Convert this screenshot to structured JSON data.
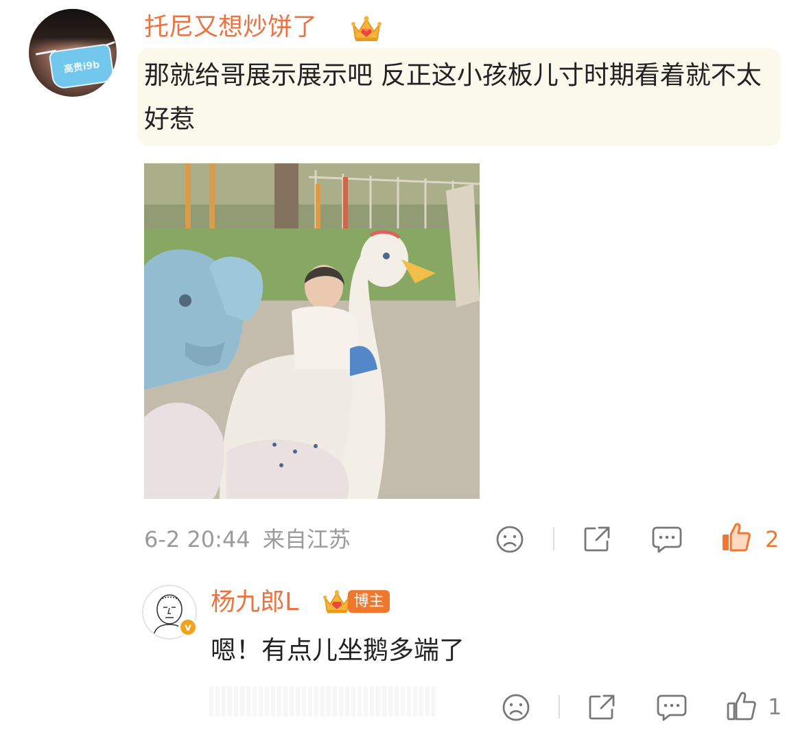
{
  "comment": {
    "username": "托尼又想炒饼了",
    "avatar_mask_text": "高贵i9b",
    "text": "那就给哥展示展示吧 反正这小孩板儿寸时期看着就不太好惹",
    "timestamp": "6-2 20:44",
    "location": "来自江苏",
    "like_count": "2",
    "liked": true
  },
  "reply": {
    "username": "杨九郎L",
    "author_tag": "博主",
    "verified_badge": "v",
    "text": "嗯！有点儿坐鹅多端了",
    "like_count": "1",
    "liked": false
  },
  "colors": {
    "username": "#eb7340",
    "like_active": "#f0772d",
    "meta": "#9a9a9a",
    "bubble": "#fbf8ec"
  },
  "icons": [
    "sad-face-icon",
    "share-icon",
    "comment-icon",
    "thumbs-up-icon",
    "crown-icon"
  ]
}
